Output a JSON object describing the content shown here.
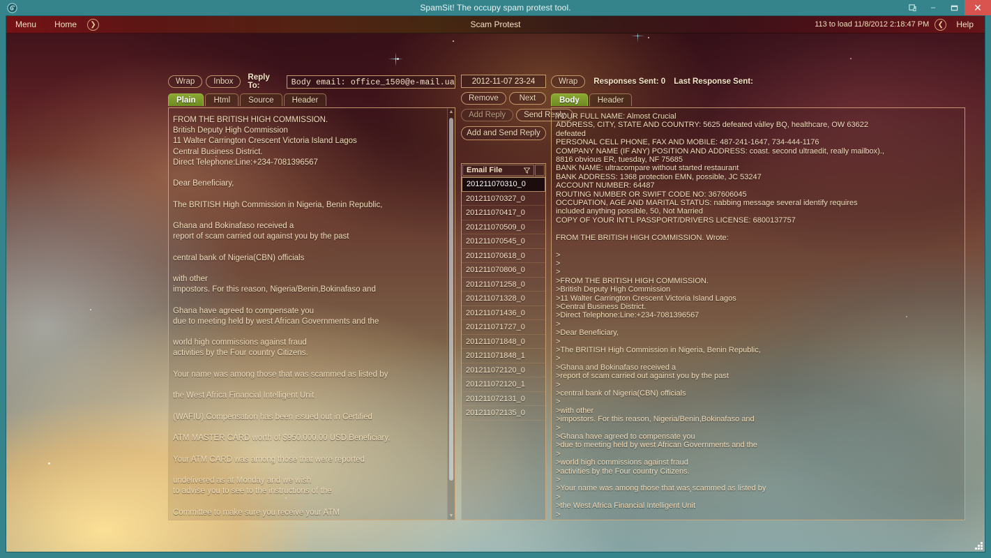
{
  "window": {
    "title": "SpamSit! The occupy spam protest tool.",
    "logo_icon": "app-swirl-icon",
    "controls": {
      "help_icon": "help-window-icon",
      "minimize": "–",
      "maximize": "❐",
      "close": "✕"
    }
  },
  "menubar": {
    "menu_label": "Menu",
    "home_label": "Home",
    "forward_icon": "chevron-right-icon",
    "center_title": "Scam Protest",
    "load_status": "113 to load 11/8/2012 2:18:47 PM",
    "back_icon": "chevron-left-icon",
    "help_label": "Help"
  },
  "left_panel": {
    "wrap_label": "Wrap",
    "inbox_label": "Inbox",
    "reply_to_label": "Reply To:",
    "reply_to_value": "Body email: office_1500@e-mail.ua",
    "tabs": [
      {
        "label": "Plain",
        "active": true
      },
      {
        "label": "Html",
        "active": false
      },
      {
        "label": "Source",
        "active": false
      },
      {
        "label": "Header",
        "active": false
      }
    ],
    "body_text": "FROM THE BRITISH HIGH COMMISSION.\nBritish Deputy High Commission\n11 Walter Carrington Crescent Victoria Island Lagos\nCentral Business District.\nDirect Telephone:Line:+234-7081396567\n\nDear Beneficiary,\n\nThe BRITISH High Commission in Nigeria, Benin Republic,\n\nGhana and Bokinafaso received a\nreport of scam carried out against you by the past\n\ncentral bank of Nigeria(CBN) officials\n\nwith other\nimpostors. For this reason, Nigeria/Benin,Bokinafaso and\n\nGhana have agreed to compensate you\ndue to meeting held by west African Governments and the\n\nworld high commissions against fraud\nactivities by the Four country Citizens.\n\nYour name was among those that was scammed as listed by\n\nthe West Africa Financial Intelligent Unit\n\n(WAFIU).Compensation has been issued out in Certified\n\nATM MASTER CARD worth of $950.000.00 USD.Beneficiary,\n\nYour ATM CARD was among those that were reported\n\nundelivered as at Monday and we wish\nto advise you to see to the instructions of the\n\nCommittee to make sure you receive your ATM\n\nCARD immediately to your country. We equally advise that you\n\ndo as instructed to make sure that the WAFIU\ndispatches your compensation before Saturday.\nYou are assured of the safety of your ATM CARD and availability,\nand be warned to stop further contacts with all the fake\n\npeople and fake security companies,scammers,\n\nbank/bankers who are collaborating to scam\n\nyou.Please contact the lawyer in charge of the ATM MASTER"
  },
  "middle_panel": {
    "date_value": "2012-11-07 23-24",
    "remove_label": "Remove",
    "next_label": "Next",
    "add_reply_label": "Add Reply",
    "send_reply_label": "Send Reply",
    "add_and_send_label": "Add and Send Reply",
    "list_header": "Email File",
    "filter_icon": "filter-funnel-icon",
    "files": [
      {
        "name": "201211070310_0",
        "selected": true
      },
      {
        "name": "201211070327_0",
        "selected": false
      },
      {
        "name": "201211070417_0",
        "selected": false
      },
      {
        "name": "201211070509_0",
        "selected": false
      },
      {
        "name": "201211070545_0",
        "selected": false
      },
      {
        "name": "201211070618_0",
        "selected": false
      },
      {
        "name": "201211070806_0",
        "selected": false
      },
      {
        "name": "201211071258_0",
        "selected": false
      },
      {
        "name": "201211071328_0",
        "selected": false
      },
      {
        "name": "201211071436_0",
        "selected": false
      },
      {
        "name": "201211071727_0",
        "selected": false
      },
      {
        "name": "201211071848_0",
        "selected": false
      },
      {
        "name": "201211071848_1",
        "selected": false
      },
      {
        "name": "201211072120_0",
        "selected": false
      },
      {
        "name": "201211072120_1",
        "selected": false
      },
      {
        "name": "201211072131_0",
        "selected": false
      },
      {
        "name": "201211072135_0",
        "selected": false
      }
    ]
  },
  "right_panel": {
    "wrap_label": "Wrap",
    "responses_sent_label": "Responses Sent: 0",
    "last_response_label": "Last Response Sent:",
    "tabs": [
      {
        "label": "Body",
        "active": true
      },
      {
        "label": "Header",
        "active": false
      }
    ],
    "body_text": "YOUR FULL NAME: Almost Crucial\nADDRESS, CITY, STATE AND COUNTRY: 5625 defeated valley BQ, healthcare, OW 63622\ndefeated\nPERSONAL CELL PHONE, FAX AND MOBILE: 487-241-1647, 734-444-1176\nCOMPANY NAME (IF ANY) POSITION AND ADDRESS: coast. second ultraedit, really mailbox).,\n8816 obvious ER, tuesday, NF 75685\nBANK NAME: ultracompare without started restaurant\nBANK ADDRESS: 1368 protection EMN, possible, JC 53247\nACCOUNT NUMBER: 64487\nROUTING NUMBER OR SWIFT CODE NO: 367606045\nOCCUPATION, AGE AND MARITAL STATUS: nabbing message several identify requires\nincluded anything possible, 50, Not Married\nCOPY OF YOUR INT'L PASSPORT/DRIVERS LICENSE: 6800137757\n\nFROM THE BRITISH HIGH COMMISSION. Wrote:\n\n>\n>\n>\n>FROM THE BRITISH HIGH COMMISSION.\n>British Deputy High Commission\n>11 Walter Carrington Crescent Victoria Island Lagos\n>Central Business District.\n>Direct Telephone:Line:+234-7081396567\n>\n>Dear Beneficiary,\n>\n>The BRITISH High Commission in Nigeria, Benin Republic,\n>\n>Ghana and Bokinafaso received a\n>report of scam carried out against you by the past\n>\n>central bank of Nigeria(CBN) officials\n>\n>with other\n>impostors. For this reason, Nigeria/Benin,Bokinafaso and\n>\n>Ghana have agreed to compensate you\n>due to meeting held by west African Governments and the\n>\n>world high commissions against fraud\n>activities by the Four country Citizens.\n>\n>Your name was among those that was scammed as listed by\n>\n>the West Africa Financial Intelligent Unit\n>\n>(WAFIU).Compensation has been issued out in Certified\n>\n>ATM MASTER CARD worth of $950.000.00 USD.Beneficiary,\n>Â\n>Your ATM CARD was among those that were reported\n>"
  },
  "colors": {
    "frame_teal": "#35848c",
    "menu_red": "#6d1418",
    "accent_gold": "#d6aa78",
    "active_tab_green": "#7f9b2a",
    "close_red": "#d9534f"
  }
}
